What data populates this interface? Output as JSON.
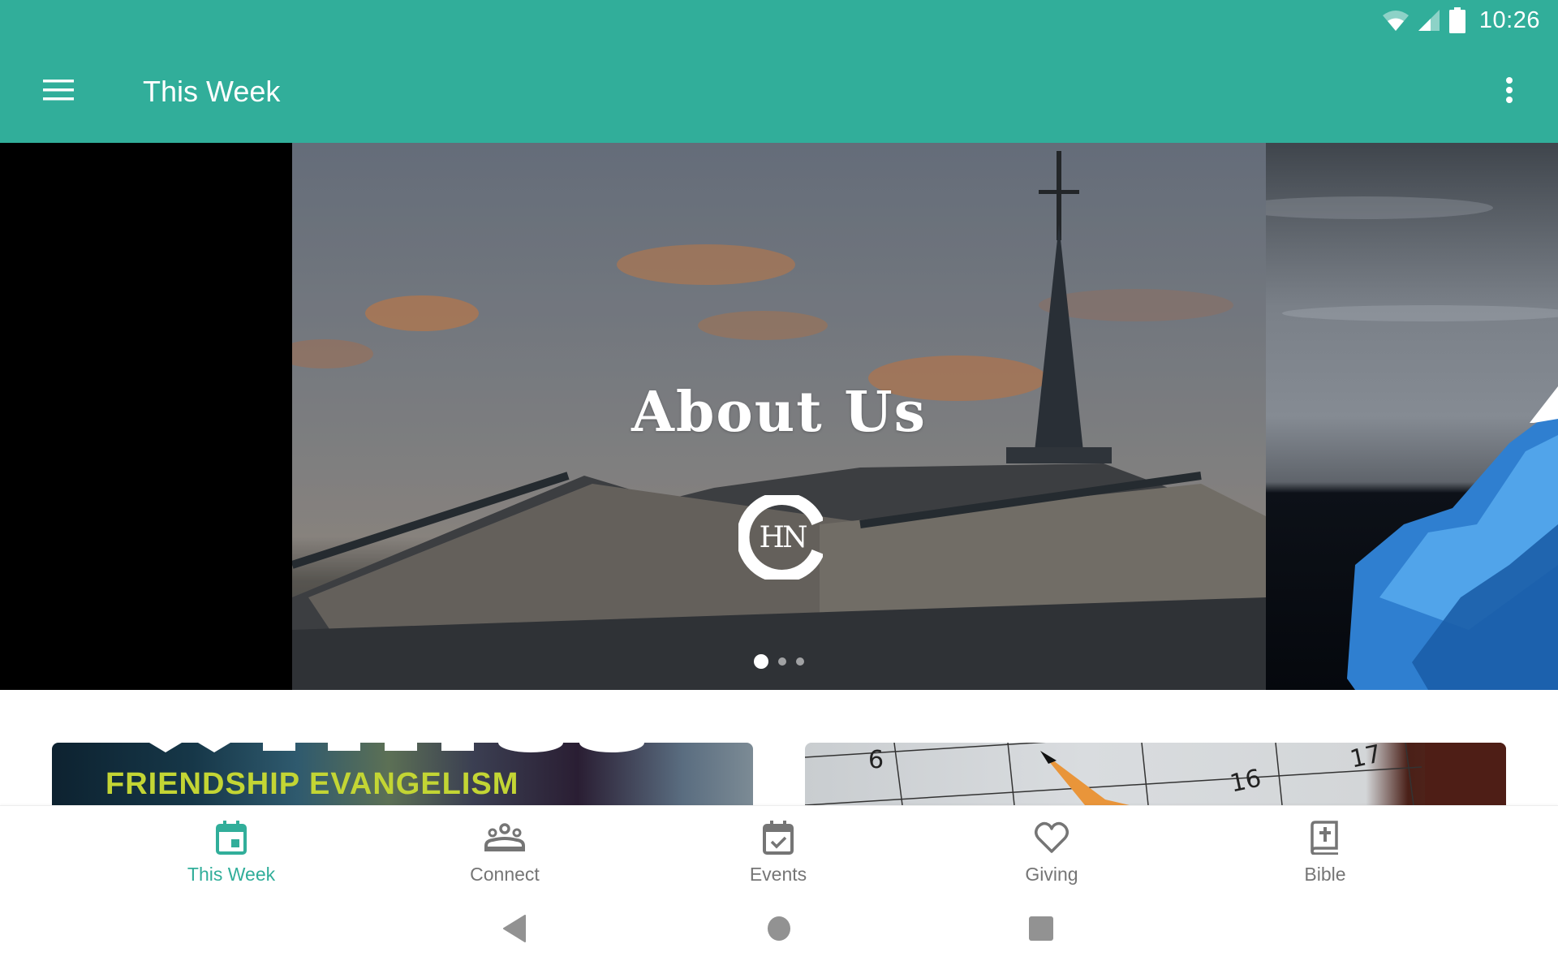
{
  "status_bar": {
    "time": "10:26",
    "icons": [
      "wifi-icon",
      "cell-signal-icon",
      "battery-icon"
    ]
  },
  "toolbar": {
    "menu_icon": "hamburger-menu-icon",
    "title": "This Week",
    "overflow_icon": "more-vert-icon"
  },
  "carousel": {
    "current_slide": {
      "title": "About Us",
      "logo_text": "HN",
      "logo_name": "church-logo"
    },
    "slide_count": 3,
    "active_index": 0
  },
  "cards": [
    {
      "title": "FRIENDSHIP EVANGELISM"
    },
    {
      "calendar_numbers": [
        "6",
        "16",
        "17"
      ]
    }
  ],
  "bottom_nav": {
    "accent_color": "#31ae9a",
    "inactive_color": "#757575",
    "items": [
      {
        "label": "This Week",
        "icon": "calendar-today-icon",
        "active": true
      },
      {
        "label": "Connect",
        "icon": "groups-icon",
        "active": false
      },
      {
        "label": "Events",
        "icon": "event-available-icon",
        "active": false
      },
      {
        "label": "Giving",
        "icon": "heart-outline-icon",
        "active": false
      },
      {
        "label": "Bible",
        "icon": "bible-book-icon",
        "active": false
      }
    ]
  },
  "system_nav": {
    "buttons": [
      "back-icon",
      "home-icon",
      "recents-icon"
    ]
  },
  "colors": {
    "primary": "#31ae9a",
    "logo_text_accent": "#c3d534"
  }
}
